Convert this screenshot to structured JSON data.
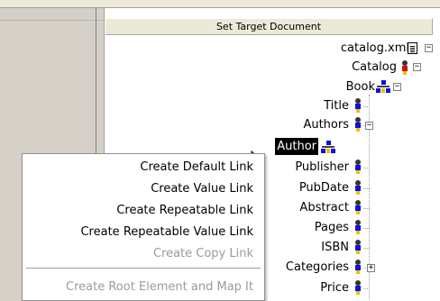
{
  "header": {
    "title": "Set Target Document"
  },
  "tree": {
    "nodes": [
      {
        "label": "catalog.xml",
        "icon": "document-icon"
      },
      {
        "label": "Catalog",
        "icon": "person-red-icon"
      },
      {
        "label": "Book",
        "icon": "branch-icon"
      },
      {
        "label": "Title",
        "icon": "person-icon"
      },
      {
        "label": "Authors",
        "icon": "person-icon"
      },
      {
        "label": "Author",
        "icon": "branch-icon",
        "selected": true
      },
      {
        "label": "Publisher",
        "icon": "person-icon"
      },
      {
        "label": "PubDate",
        "icon": "person-icon"
      },
      {
        "label": "Abstract",
        "icon": "person-icon"
      },
      {
        "label": "Pages",
        "icon": "person-icon"
      },
      {
        "label": "ISBN",
        "icon": "person-icon"
      },
      {
        "label": "Categories",
        "icon": "person-icon"
      },
      {
        "label": "Price",
        "icon": "person-icon"
      }
    ],
    "expander_collapse": "−",
    "expander_expand": "+"
  },
  "context_menu": {
    "items": [
      {
        "label": "Create Default Link",
        "enabled": true
      },
      {
        "label": "Create Value Link",
        "enabled": true
      },
      {
        "label": "Create Repeatable Link",
        "enabled": true
      },
      {
        "label": "Create Repeatable Value Link",
        "enabled": true
      },
      {
        "label": "Create Copy Link",
        "enabled": false
      },
      {
        "label": "Create Root Element and Map It",
        "enabled": false
      }
    ]
  },
  "colors": {
    "selection_bg": "#000000",
    "disabled_text": "#9a9a9a",
    "panel_gray": "#d4d0c8"
  }
}
